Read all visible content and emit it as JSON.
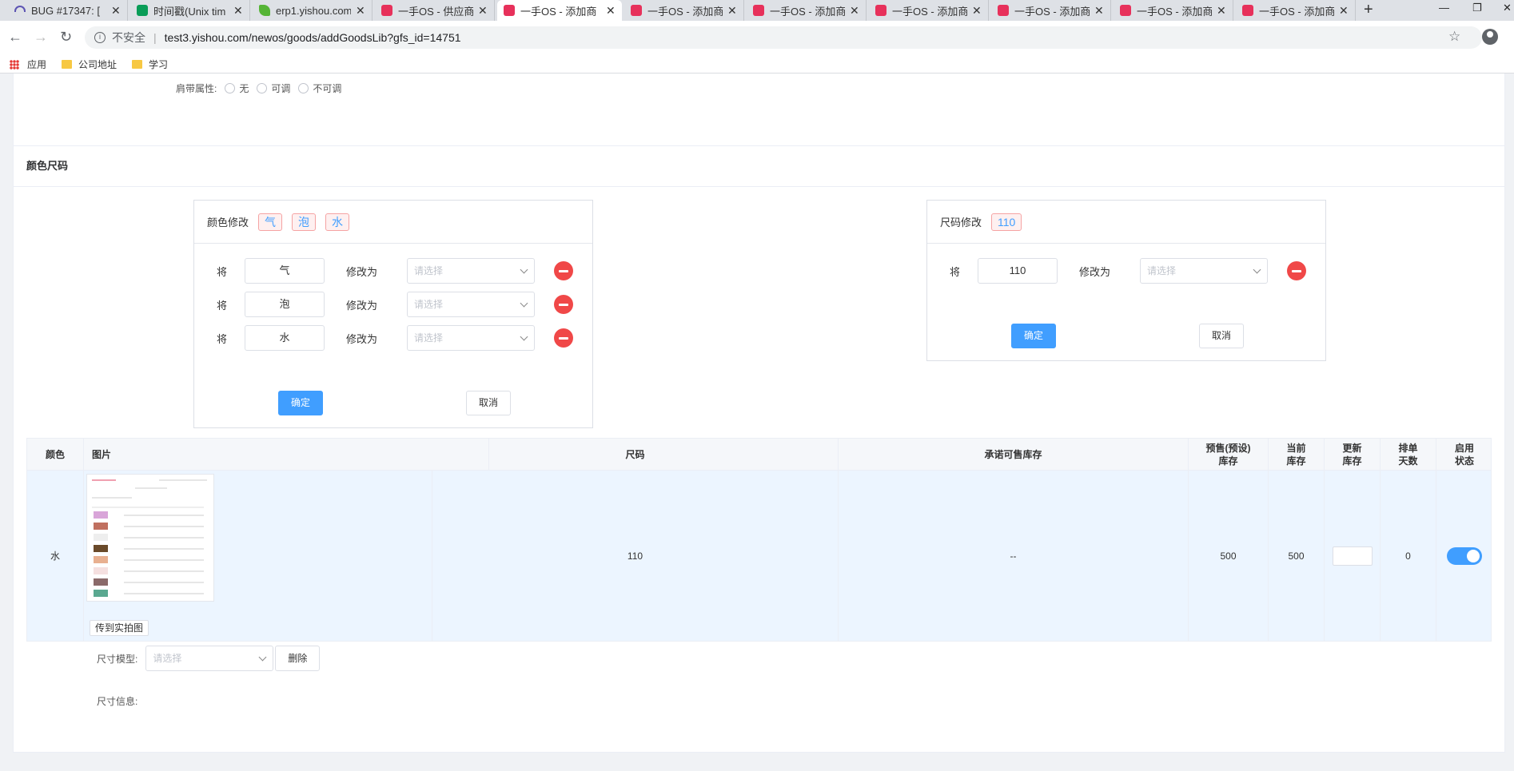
{
  "browser": {
    "tabs": [
      {
        "title": "BUG #17347: [",
        "icon": "zentao-icon"
      },
      {
        "title": "时间戳(Unix tim",
        "icon": "timestamp-icon"
      },
      {
        "title": "erp1.yishou.com",
        "icon": "leaf-icon"
      },
      {
        "title": "一手OS - 供应商",
        "icon": "yishou-icon"
      },
      {
        "title": "一手OS - 添加商",
        "icon": "yishou-icon",
        "active": true
      },
      {
        "title": "一手OS - 添加商",
        "icon": "yishou-icon"
      },
      {
        "title": "一手OS - 添加商",
        "icon": "yishou-icon"
      },
      {
        "title": "一手OS - 添加商",
        "icon": "yishou-icon"
      },
      {
        "title": "一手OS - 添加商",
        "icon": "yishou-icon"
      },
      {
        "title": "一手OS - 添加商",
        "icon": "yishou-icon"
      },
      {
        "title": "一手OS - 添加商",
        "icon": "yishou-icon"
      }
    ],
    "new_tab": "+",
    "insecure_label": "不安全",
    "url": "test3.yishou.com/newos/goods/addGoodsLib?gfs_id=14751",
    "bookmarks": {
      "apps": "应用",
      "company": "公司地址",
      "study": "学习"
    }
  },
  "strap": {
    "label": "肩带属性:",
    "options": [
      "无",
      "可调",
      "不可调"
    ]
  },
  "section": {
    "title": "颜色尺码"
  },
  "color_mod": {
    "title": "颜色修改",
    "chips": [
      "气",
      "泡",
      "水"
    ],
    "rows": [
      {
        "from_label": "将",
        "value": "气",
        "to_label": "修改为",
        "placeholder": "请选择"
      },
      {
        "from_label": "将",
        "value": "泡",
        "to_label": "修改为",
        "placeholder": "请选择"
      },
      {
        "from_label": "将",
        "value": "水",
        "to_label": "修改为",
        "placeholder": "请选择"
      }
    ],
    "confirm": "确定",
    "cancel": "取消"
  },
  "size_mod": {
    "title": "尺码修改",
    "chips": [
      "110"
    ],
    "rows": [
      {
        "from_label": "将",
        "value": "110",
        "to_label": "修改为",
        "placeholder": "请选择"
      }
    ],
    "confirm": "确定",
    "cancel": "取消"
  },
  "table": {
    "headers": {
      "color": "颜色",
      "image": "图片",
      "size": "尺码",
      "promised": "承诺可售库存",
      "presale": "预售(预设)库存",
      "current": "当前库存",
      "update": "更新库存",
      "schedule": "排单天数",
      "status": "启用状态"
    },
    "rows": [
      {
        "color": "水",
        "size": "110",
        "promised": "--",
        "presale": "500",
        "current": "500",
        "update": "",
        "schedule": "0",
        "enabled": true,
        "upload_btn": "传到实拍图"
      }
    ]
  },
  "size_model": {
    "label": "尺寸模型:",
    "placeholder": "请选择",
    "delete": "删除"
  },
  "size_info": {
    "label": "尺寸信息:"
  }
}
